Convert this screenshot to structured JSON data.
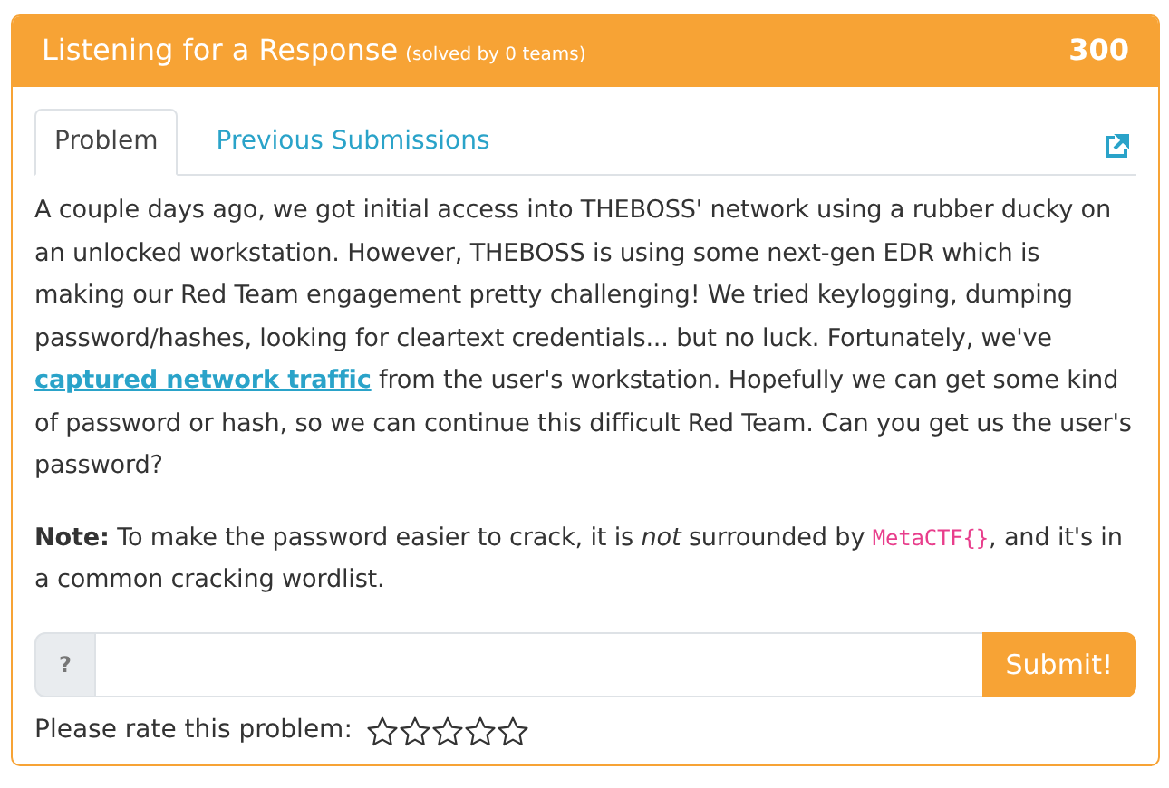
{
  "header": {
    "title": "Listening for a Response",
    "solved": "(solved by 0 teams)",
    "points": "300"
  },
  "tabs": [
    {
      "label": "Problem",
      "selected": true
    },
    {
      "label": "Previous Submissions",
      "selected": false
    }
  ],
  "description": {
    "before": "A couple days ago, we got initial access into THEBOSS' network using a rubber ducky on an unlocked workstation. However, THEBOSS is using some next-gen EDR which is making our Red Team engagement pretty challenging! We tried keylogging, dumping password/hashes, looking for cleartext credentials... but no luck. Fortunately, we've ",
    "link": "captured network traffic",
    "after": " from the user's workstation. Hopefully we can get some kind of password or hash, so we can continue this difficult Red Team. Can you get us the user's password?"
  },
  "note": {
    "before": "**Note:** To make the password easier to crack, it is *not* surrounded by ",
    "code": "MetaCTF{}",
    "after": ", and it's in a common cracking wordlist."
  },
  "answer": {
    "addon": "?",
    "button": "Submit!"
  },
  "rating": {
    "label": "Please rate this problem:",
    "stars": 0
  }
}
